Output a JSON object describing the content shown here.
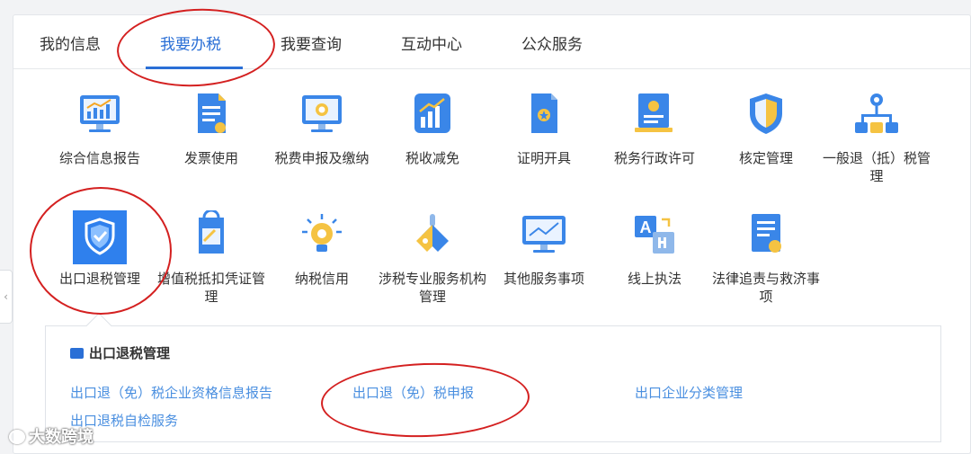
{
  "tabs": [
    {
      "label": "我的信息",
      "active": false
    },
    {
      "label": "我要办税",
      "active": true
    },
    {
      "label": "我要查询",
      "active": false
    },
    {
      "label": "互动中心",
      "active": false
    },
    {
      "label": "公众服务",
      "active": false
    }
  ],
  "grid_row1": [
    {
      "label": "综合信息报告",
      "icon": "monitor-chart-icon"
    },
    {
      "label": "发票使用",
      "icon": "invoice-icon"
    },
    {
      "label": "税费申报及缴纳",
      "icon": "monitor-coin-icon"
    },
    {
      "label": "税收减免",
      "icon": "bar-chart-icon"
    },
    {
      "label": "证明开具",
      "icon": "certificate-icon"
    },
    {
      "label": "税务行政许可",
      "icon": "license-icon"
    },
    {
      "label": "核定管理",
      "icon": "shield-icon"
    },
    {
      "label": "一般退（抵）税管理",
      "icon": "org-chart-icon"
    }
  ],
  "grid_row2": [
    {
      "label": "出口退税管理",
      "icon": "shield-check-icon"
    },
    {
      "label": "增值税抵扣凭证管理",
      "icon": "voucher-icon"
    },
    {
      "label": "纳税信用",
      "icon": "lightbulb-icon"
    },
    {
      "label": "涉税专业服务机构管理",
      "icon": "tag-icon"
    },
    {
      "label": "其他服务事项",
      "icon": "monitor-line-icon"
    },
    {
      "label": "线上执法",
      "icon": "translate-icon"
    },
    {
      "label": "法律追责与救济事项",
      "icon": "document-icon"
    }
  ],
  "submenu": {
    "title": "出口退税管理",
    "links": [
      "出口退（免）税企业资格信息报告",
      "出口退（免）税申报",
      "出口企业分类管理",
      "出口退税自检服务"
    ]
  },
  "side_button": "‹",
  "watermark": "大数跨境",
  "colors": {
    "accent": "#2a6fd6",
    "link": "#4a8fe0",
    "annotation": "#d42020"
  }
}
